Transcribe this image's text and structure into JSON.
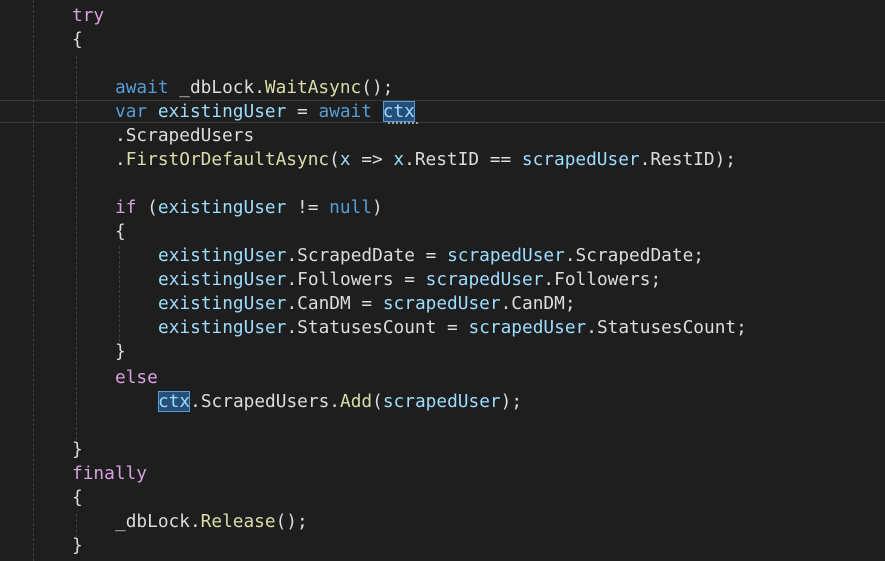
{
  "code": {
    "l1": {
      "kw": "try"
    },
    "l2": {
      "brace": "{"
    },
    "l4": {
      "await": "await",
      "obj": "_dbLock",
      "dot": ".",
      "method": "WaitAsync",
      "rest": "();"
    },
    "l5": {
      "var": "var",
      "name": "existingUser",
      "eq": " = ",
      "await": "await",
      "ctx": "ctx"
    },
    "l6": {
      "text": ".ScrapedUsers"
    },
    "l7": {
      "dot": ".",
      "method": "FirstOrDefaultAsync",
      "open": "(",
      "x1": "x",
      "arrow": " => ",
      "x2": "x",
      "prop": ".RestID",
      "eqeq": " == ",
      "arg": "scrapedUser",
      "prop2": ".RestID",
      "close": ");"
    },
    "l9": {
      "if": "if",
      "open": " (",
      "name": "existingUser",
      "neq": " != ",
      "null": "null",
      "close": ")"
    },
    "l10": {
      "brace": "{"
    },
    "l11": {
      "obj": "existingUser",
      "prop": ".ScrapedDate",
      "eq": " = ",
      "src": "scrapedUser",
      "srcprop": ".ScrapedDate;"
    },
    "l12": {
      "obj": "existingUser",
      "prop": ".Followers",
      "eq": " = ",
      "src": "scrapedUser",
      "srcprop": ".Followers;"
    },
    "l13": {
      "obj": "existingUser",
      "prop": ".CanDM",
      "eq": " = ",
      "src": "scrapedUser",
      "srcprop": ".CanDM;"
    },
    "l14": {
      "obj": "existingUser",
      "prop": ".StatusesCount",
      "eq": " = ",
      "src": "scrapedUser",
      "srcprop": ".StatusesCount;"
    },
    "l15": {
      "brace": "}"
    },
    "l16": {
      "kw": "else"
    },
    "l17": {
      "ctx": "ctx",
      "member": ".ScrapedUsers.",
      "method": "Add",
      "open": "(",
      "arg": "scrapedUser",
      "close": ");"
    },
    "l19": {
      "brace": "}"
    },
    "l20": {
      "kw": "finally"
    },
    "l21": {
      "brace": "{"
    },
    "l22": {
      "obj": "_dbLock",
      "dot": ".",
      "method": "Release",
      "rest": "();"
    },
    "l23": {
      "brace": "}"
    }
  },
  "colors": {
    "background": "#1e1e1e",
    "control_keyword": "#d8a0df",
    "keyword": "#569cd6",
    "identifier": "#9cdcfe",
    "method": "#dcdcaa",
    "plain": "#dcdcdc",
    "highlight": "#264f78"
  }
}
